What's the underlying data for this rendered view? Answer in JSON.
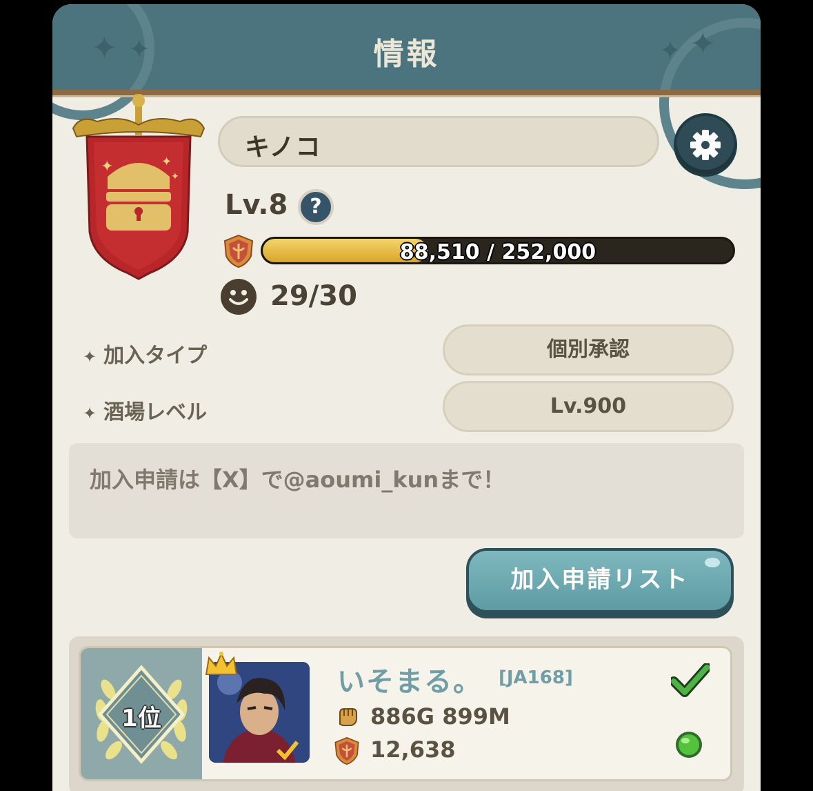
{
  "header": {
    "title": "情報"
  },
  "guild": {
    "name": "キノコ",
    "level_label": "Lv.8",
    "help_glyph": "?",
    "xp_text": "88,510 / 252,000",
    "xp_progress": 0.351,
    "members_text": "29/30"
  },
  "settings": [
    {
      "label": "加入タイプ",
      "value": "個別承認"
    },
    {
      "label": "酒場レベル",
      "value": "Lv.900"
    }
  ],
  "description": "加入申請は【X】で@aoumi_kunまで！",
  "apply_list_button": "加入申請リスト",
  "ranking": {
    "rank": "1位",
    "player_name": "いそまる。",
    "player_id": "[JA168]",
    "power": "886G 899M",
    "contribution": "12,638"
  },
  "colors": {
    "header_bg": "#4c747e",
    "panel_bg": "#f0ede5",
    "accent_teal": "#6f9ea6",
    "xp_gold": "#e3b53d",
    "check_green": "#3fa23c"
  },
  "icons": [
    "gear-icon",
    "help-icon",
    "guild-badge-icon",
    "member-face-icon",
    "sparkle-icon",
    "crown-icon",
    "fist-icon",
    "check-icon",
    "online-dot-icon"
  ]
}
